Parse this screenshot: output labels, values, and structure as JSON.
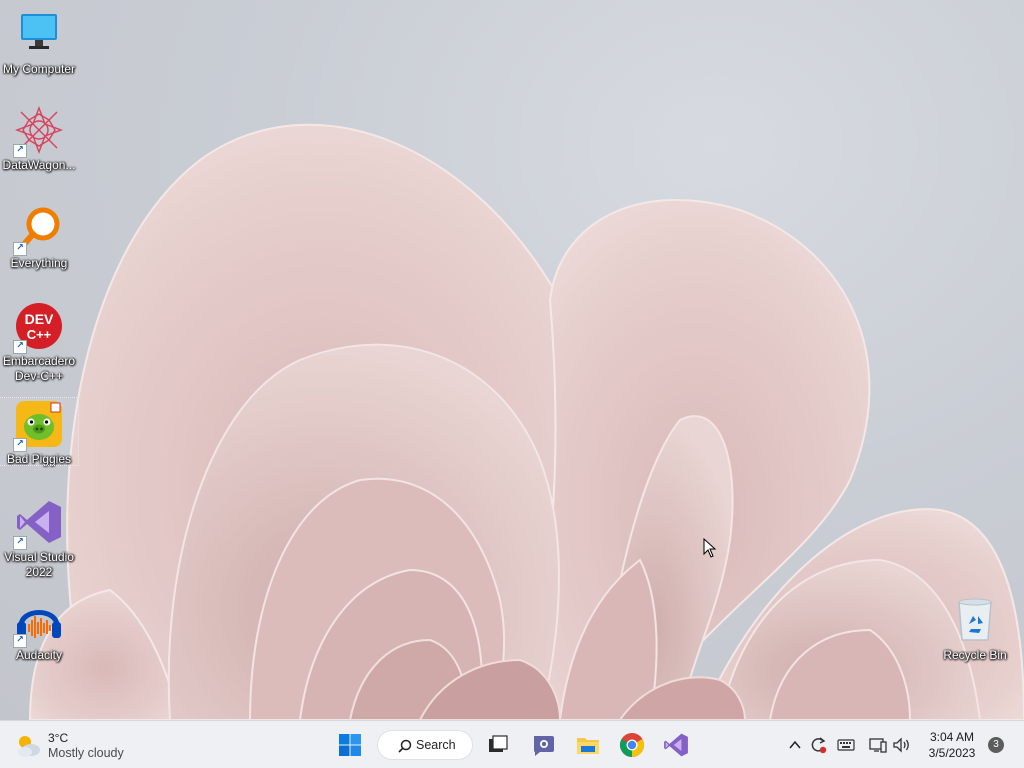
{
  "desktop": {
    "icons": [
      {
        "label": "My Computer",
        "icon": "monitor-icon"
      },
      {
        "label": "DataWagon...",
        "icon": "datawagon-icon"
      },
      {
        "label": "Everything",
        "icon": "everything-search-icon"
      },
      {
        "label": "Embarcadero Dev-C++",
        "icon": "devcpp-icon",
        "glyph": "DEV\nC++"
      },
      {
        "label": "Bad Piggies",
        "icon": "bad-piggies-icon"
      },
      {
        "label": "Visual Studio 2022",
        "icon": "visual-studio-icon"
      },
      {
        "label": "Audacity",
        "icon": "audacity-icon"
      },
      {
        "label": "Recycle Bin",
        "icon": "recycle-bin-icon"
      }
    ]
  },
  "taskbar": {
    "weather": {
      "temp": "3°C",
      "condition": "Mostly cloudy",
      "icon": "partly-cloudy-icon"
    },
    "search_label": "Search",
    "pinned": [
      {
        "name": "start",
        "icon": "windows-logo-icon"
      },
      {
        "name": "task-view",
        "icon": "task-view-icon"
      },
      {
        "name": "chat",
        "icon": "teams-chat-icon"
      },
      {
        "name": "file-explorer",
        "icon": "folder-icon"
      },
      {
        "name": "chrome",
        "icon": "chrome-icon"
      },
      {
        "name": "visual-studio",
        "icon": "visual-studio-icon"
      }
    ],
    "tray": {
      "time": "3:04 AM",
      "date": "3/5/2023",
      "notification_count": "3"
    }
  },
  "colors": {
    "accent": "#0078d4",
    "taskbar_bg": "#eef0f3",
    "wallpaper_petal": "#e2c6c4"
  }
}
